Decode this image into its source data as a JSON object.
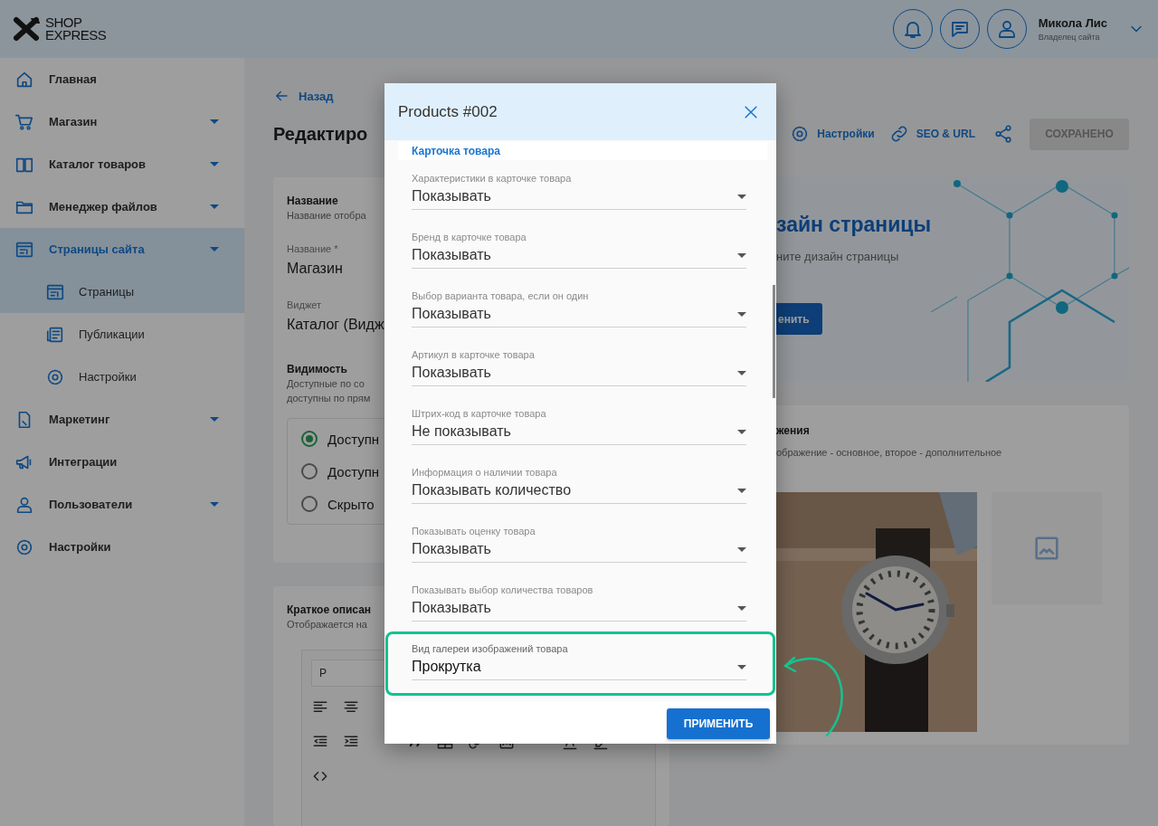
{
  "header": {
    "logo": {
      "line1": "SHOP",
      "line2": "EXPRESS"
    },
    "user": {
      "name": "Микола Лис",
      "role": "Владелец сайта"
    }
  },
  "sidebar": {
    "items": [
      {
        "label": "Главная",
        "has_submenu": false,
        "selected": false
      },
      {
        "label": "Магазин",
        "has_submenu": true,
        "selected": false
      },
      {
        "label": "Каталог товаров",
        "has_submenu": true,
        "selected": false
      },
      {
        "label": "Менеджер файлов",
        "has_submenu": true,
        "selected": false
      },
      {
        "label": "Страницы сайта",
        "has_submenu": true,
        "selected": true,
        "children": [
          {
            "label": "Страницы",
            "selected": true
          },
          {
            "label": "Публикации",
            "selected": false
          },
          {
            "label": "Настройки",
            "selected": false
          }
        ]
      },
      {
        "label": "Маркетинг",
        "has_submenu": true,
        "selected": false
      },
      {
        "label": "Интеграции",
        "has_submenu": false,
        "selected": false
      },
      {
        "label": "Пользователи",
        "has_submenu": true,
        "selected": false
      },
      {
        "label": "Настройки",
        "has_submenu": false,
        "selected": false
      }
    ]
  },
  "page": {
    "back_link": "Назад",
    "title": "Редактиро",
    "toolbar": {
      "settings": "Настройки",
      "seo": "SEO & URL",
      "save_button": {
        "label": "СОХРАНЕНО",
        "disabled": true
      }
    },
    "general_card": {
      "title": "Название",
      "subtitle": "Название отобра",
      "fields": [
        {
          "label": "Название *",
          "value": "Магазин"
        },
        {
          "label": "Виджет",
          "value": "Каталог (Видж"
        }
      ],
      "visibility": {
        "title": "Видимость",
        "description": [
          "Доступные по со",
          "доступны по прям"
        ],
        "options": [
          {
            "label": "Доступн",
            "selected": true
          },
          {
            "label": "Доступн",
            "selected": false
          },
          {
            "label": "Скрыто",
            "selected": false
          }
        ]
      }
    },
    "description_card": {
      "title": "Краткое описан",
      "subtitle": "Отображается на",
      "editor": {
        "format": "P"
      }
    },
    "design_card": {
      "title": "зайн страницы",
      "subtitle": "ните дизайн страницы",
      "button": "енить"
    },
    "images_card": {
      "title": "жения",
      "subtitle": "ображение - основное, второе - дополнительное",
      "images": [
        {
          "kind": "picture"
        },
        {
          "kind": "empty"
        }
      ]
    }
  },
  "dialog": {
    "title": "Products #002",
    "section": "Карточка товара",
    "fields": [
      {
        "label": "Характеристики в карточке товара",
        "value": "Показывать",
        "highlighted": false
      },
      {
        "label": "Бренд в карточке товара",
        "value": "Показывать",
        "highlighted": false
      },
      {
        "label": "Выбор варианта товара, если он один",
        "value": "Показывать",
        "highlighted": false
      },
      {
        "label": "Артикул в карточке товара",
        "value": "Показывать",
        "highlighted": false
      },
      {
        "label": "Штрих-код в карточке товара",
        "value": "Не показывать",
        "highlighted": false
      },
      {
        "label": "Информация о наличии товара",
        "value": "Показывать количество",
        "highlighted": false
      },
      {
        "label": "Показывать оценку товара",
        "value": "Показывать",
        "highlighted": false
      },
      {
        "label": "Показывать выбор количества товаров",
        "value": "Показывать",
        "highlighted": false
      },
      {
        "label": "Вид галереи изображений товара",
        "value": "Прокрутка",
        "highlighted": true
      }
    ],
    "apply_button": "ПРИМЕНИТЬ"
  }
}
